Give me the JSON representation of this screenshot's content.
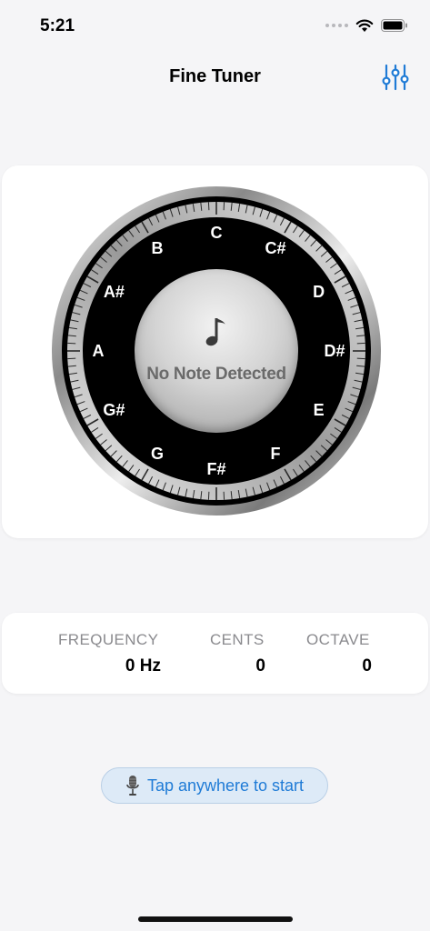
{
  "status_bar": {
    "time": "5:21"
  },
  "nav": {
    "title": "Fine Tuner",
    "settings_icon": "sliders-icon"
  },
  "tuner": {
    "notes": [
      "C",
      "C#",
      "D",
      "D#",
      "E",
      "F",
      "F#",
      "G",
      "G#",
      "A",
      "A#",
      "B"
    ],
    "center_icon": "music-note-icon",
    "status_text": "No Note Detected"
  },
  "readout": {
    "frequency_label": "FREQUENCY",
    "frequency_value": "0 Hz",
    "cents_label": "CENTS",
    "cents_value": "0",
    "octave_label": "OCTAVE",
    "octave_value": "0"
  },
  "start_button": {
    "label": "Tap anywhere to start",
    "icon": "microphone-icon"
  },
  "colors": {
    "accent": "#1f7bd6",
    "pill_bg": "#ddeaf7",
    "dial_face": "#000000"
  }
}
